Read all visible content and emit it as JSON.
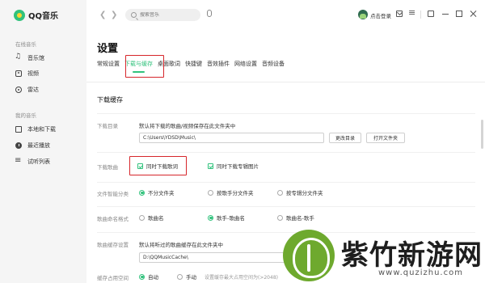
{
  "app": {
    "name": "QQ音乐"
  },
  "sidebar": {
    "online_title": "在线音乐",
    "online_items": [
      {
        "label": "音乐馆",
        "icon": "music-note-icon"
      },
      {
        "label": "视频",
        "icon": "video-icon"
      },
      {
        "label": "雷达",
        "icon": "radar-icon"
      }
    ],
    "my_title": "我的音乐",
    "my_items": [
      {
        "label": "本地和下载",
        "icon": "local-download-icon"
      },
      {
        "label": "最近播放",
        "icon": "recent-icon"
      },
      {
        "label": "试听列表",
        "icon": "list-icon"
      }
    ]
  },
  "topbar": {
    "search_placeholder": "搜索音乐",
    "login_label": "点击登录"
  },
  "settings": {
    "title": "设置",
    "tabs": [
      "常规设置",
      "下载与缓存",
      "桌面歌词",
      "快捷键",
      "音效插件",
      "网络设置",
      "音频设备"
    ],
    "active_tab": "下载与缓存",
    "section_title": "下载缓存",
    "download_dir": {
      "label": "下载目录",
      "desc": "默认将下载的歌曲/视频保存在此文件夹中",
      "path": "C:\\Users\\YDSD\\Music\\",
      "change_button": "更改目录",
      "open_button": "打开文件夹"
    },
    "download_lyrics": {
      "label": "下载歌曲",
      "opt1": "同时下载歌词",
      "opt2": "同时下载专辑图片"
    },
    "smart_folder": {
      "label": "文件智能分类",
      "options": [
        "不分文件夹",
        "按歌手分文件夹",
        "按专辑分文件夹"
      ],
      "selected": 0
    },
    "naming_format": {
      "label": "歌曲命名格式",
      "options": [
        "歌曲名",
        "歌手-歌曲名",
        "歌曲名-歌手"
      ],
      "selected": 1
    },
    "cache_dir": {
      "label": "歌曲缓存设置",
      "desc": "默认将听过的歌曲缓存在此文件夹中",
      "path": "D:\\QQMusicCache\\"
    },
    "cache_space": {
      "label": "缓存占用空间",
      "options": [
        "自动",
        "手动"
      ],
      "selected": 0,
      "hint": "设置缓存最大占用空间为(>2048)"
    }
  },
  "watermark": {
    "title": "紫竹新游网",
    "url": "www.quzizhu.com"
  },
  "colors": {
    "accent": "#31c27c",
    "highlight_box": "#d6262b"
  }
}
